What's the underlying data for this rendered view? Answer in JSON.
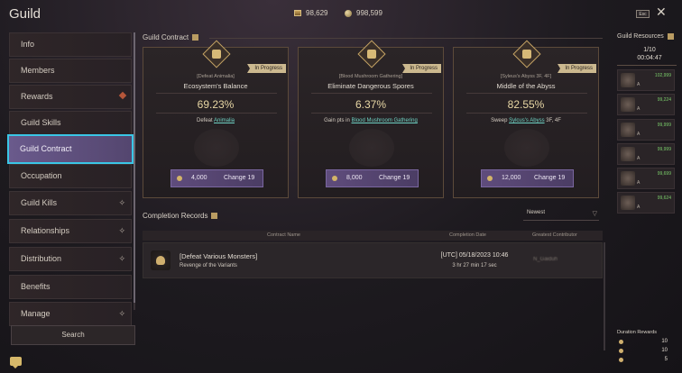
{
  "app": {
    "title": "Guild"
  },
  "topbar": {
    "currency_1": "98,629",
    "currency_2": "998,599",
    "esc_label": "Esc"
  },
  "sidebar": {
    "items": [
      {
        "label": "Info"
      },
      {
        "label": "Members"
      },
      {
        "label": "Rewards"
      },
      {
        "label": "Guild Skills"
      },
      {
        "label": "Guild Contract",
        "active": true
      },
      {
        "label": "Occupation"
      },
      {
        "label": "Guild Kills"
      },
      {
        "label": "Relationships"
      },
      {
        "label": "Distribution"
      },
      {
        "label": "Benefits"
      },
      {
        "label": "Manage"
      }
    ],
    "search_label": "Search"
  },
  "contracts": {
    "title": "Guild Contract",
    "cards": [
      {
        "category": "[Defeat Animalia]",
        "name": "Ecosystem's Balance",
        "status": "In Progress",
        "percent": "69.23%",
        "task_prefix": "Defeat ",
        "task_link": "Animalia",
        "task_suffix": "",
        "amount": "4,000",
        "change_label": "Change 19"
      },
      {
        "category": "[Blood Mushroom Gathering]",
        "name": "Eliminate Dangerous Spores",
        "status": "In Progress",
        "percent": "6.37%",
        "task_prefix": "Gain pts in ",
        "task_link": "Blood Mushroom Gathering",
        "task_suffix": "",
        "amount": "8,000",
        "change_label": "Change 19"
      },
      {
        "category": "[Syleus's Abyss 3F, 4F]",
        "name": "Middle of the Abyss",
        "status": "In Progress",
        "percent": "82.55%",
        "task_prefix": "Sweep ",
        "task_link": "Sylcus's Abyss",
        "task_suffix": " 3F, 4F",
        "amount": "12,000",
        "change_label": "Change 19"
      }
    ]
  },
  "records": {
    "title": "Completion Records",
    "sort": "Newest",
    "columns": [
      "Contract Name",
      "Completion Date",
      "Greatest Contributor"
    ],
    "rows": [
      {
        "name": "[Defeat Various Monsters]",
        "sub": "Revenge of the Variants",
        "date": "[UTC] 05/18/2023 10:46",
        "duration": "3 hr 27 min 17 sec",
        "contributor": "N_Gaiduh"
      }
    ]
  },
  "resources": {
    "title": "Guild Resources",
    "count": "1/10",
    "timer": "00:04:47",
    "items": [
      {
        "value": "102,999",
        "grade": "A"
      },
      {
        "value": "99,224",
        "grade": "A"
      },
      {
        "value": "99,999",
        "grade": "A"
      },
      {
        "value": "99,999",
        "grade": "A"
      },
      {
        "value": "99,699",
        "grade": "A"
      },
      {
        "value": "99,624",
        "grade": "A"
      }
    ],
    "duration_title": "Duration Rewards",
    "duration_rows": [
      {
        "value": "10"
      },
      {
        "value": "10"
      },
      {
        "value": "5"
      }
    ]
  }
}
